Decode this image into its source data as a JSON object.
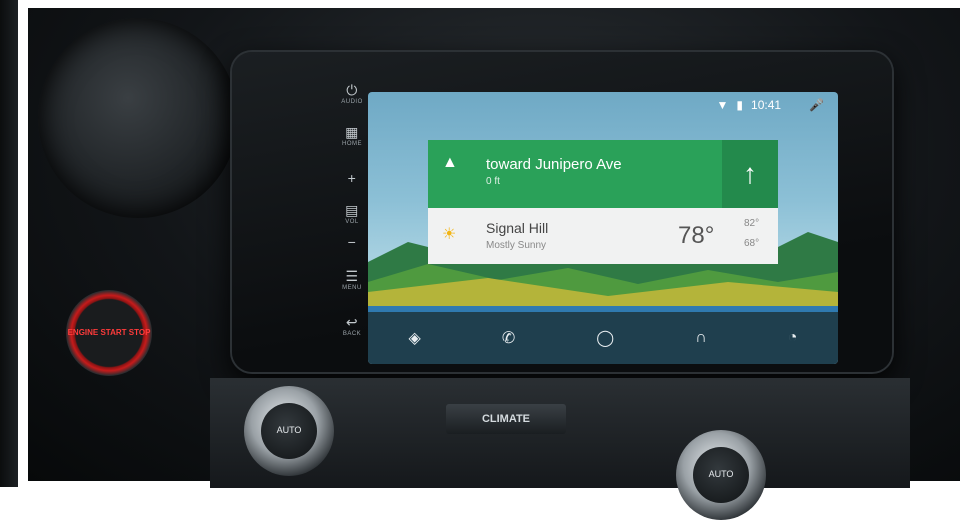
{
  "screen": {
    "status": {
      "time": "10:41",
      "icons": [
        "wifi-icon",
        "battery-icon",
        "mic-icon"
      ]
    },
    "navigation": {
      "street": "toward Junipero Ave",
      "distance": "0 ft",
      "turn_icon": "navigation-arrow-icon",
      "next_turn_icon": "arrow-up-icon"
    },
    "weather": {
      "location": "Signal Hill",
      "condition": "Mostly Sunny",
      "temp": "78°",
      "high": "82°",
      "low": "68°",
      "icon": "partly-sunny-icon"
    },
    "dock": [
      {
        "name": "navigation",
        "icon": "navigation-icon"
      },
      {
        "name": "phone",
        "icon": "phone-icon"
      },
      {
        "name": "home",
        "icon": "home-circle-icon"
      },
      {
        "name": "audio",
        "icon": "headphones-icon"
      },
      {
        "name": "recent",
        "icon": "recent-icon"
      }
    ]
  },
  "bezel_buttons": {
    "audio": "AUDIO",
    "home": "HOME",
    "vol": "VOL",
    "menu": "MENU",
    "back": "BACK"
  },
  "controls": {
    "engine": "ENGINE START STOP",
    "left_knob": "AUTO",
    "climate": "CLIMATE",
    "right_knob": "AUTO"
  },
  "colors": {
    "nav_green": "#2aa159",
    "dock_bg": "#1f3f4e",
    "engine_red": "#c61b1b"
  }
}
